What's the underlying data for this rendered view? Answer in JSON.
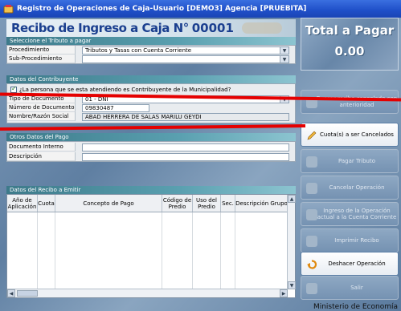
{
  "window": {
    "title": "Registro de Operaciones de Caja-Usuario [DEMO3] Agencia [PRUEBITA]"
  },
  "recibo": {
    "title": "Recibo de Ingreso a Caja N°",
    "number": "00001"
  },
  "tributo_section": {
    "header": "Seleccione el Tributo a pagar",
    "procedimiento_label": "Procedimiento",
    "procedimiento_value": "Tributos y Tasas con Cuenta Corriente",
    "subprocedimiento_label": "Sub-Procedimiento",
    "subprocedimiento_value": ""
  },
  "contribuyente_section": {
    "header": "Datos del Contribuyente",
    "check_label": "¿La persona que se esta atendiendo es Contribuyente de la Municipalidad?",
    "tipo_doc_label": "Tipo de Documento",
    "tipo_doc_value": "01 - DNI",
    "num_doc_label": "Número de Documento",
    "num_doc_value": "09830487",
    "nombre_label": "Nombre/Razón Social",
    "nombre_value": "ABAD HERRERA DE SALAS MARILU GEYDI"
  },
  "otros_section": {
    "header": "Otros Datos del Pago",
    "doc_interno_label": "Documento Interno",
    "doc_interno_value": "",
    "descripcion_label": "Descripción",
    "descripcion_value": ""
  },
  "table": {
    "header": "Datos del Recibo a Emitir",
    "columns": [
      "Año de Aplicación",
      "Cuota",
      "Concepto de Pago",
      "Código de Predio",
      "Uso del Predio",
      "Sec.",
      "Descripción Grupo"
    ],
    "rows": []
  },
  "total": {
    "label": "Total a Pagar",
    "value": "0.00"
  },
  "side_buttons": {
    "buscar": "Buscar recibo cancelado con anterioridad",
    "cuotas": "Cuota(s) a ser Cancelados",
    "pagar": "Pagar Tributo",
    "cancelar": "Cancelar Operación",
    "ingreso": "Ingreso de la Operación actual a la Cuenta Corriente",
    "imprimir": "Imprimir Recibo",
    "deshacer": "Deshacer Operación",
    "salir": "Salir"
  },
  "footer": {
    "text": "Ministerio de Economía"
  },
  "colors": {
    "titlebar": "#1f4fc8",
    "accent_red": "#e50000",
    "brand_blue": "#1b3f8f"
  }
}
